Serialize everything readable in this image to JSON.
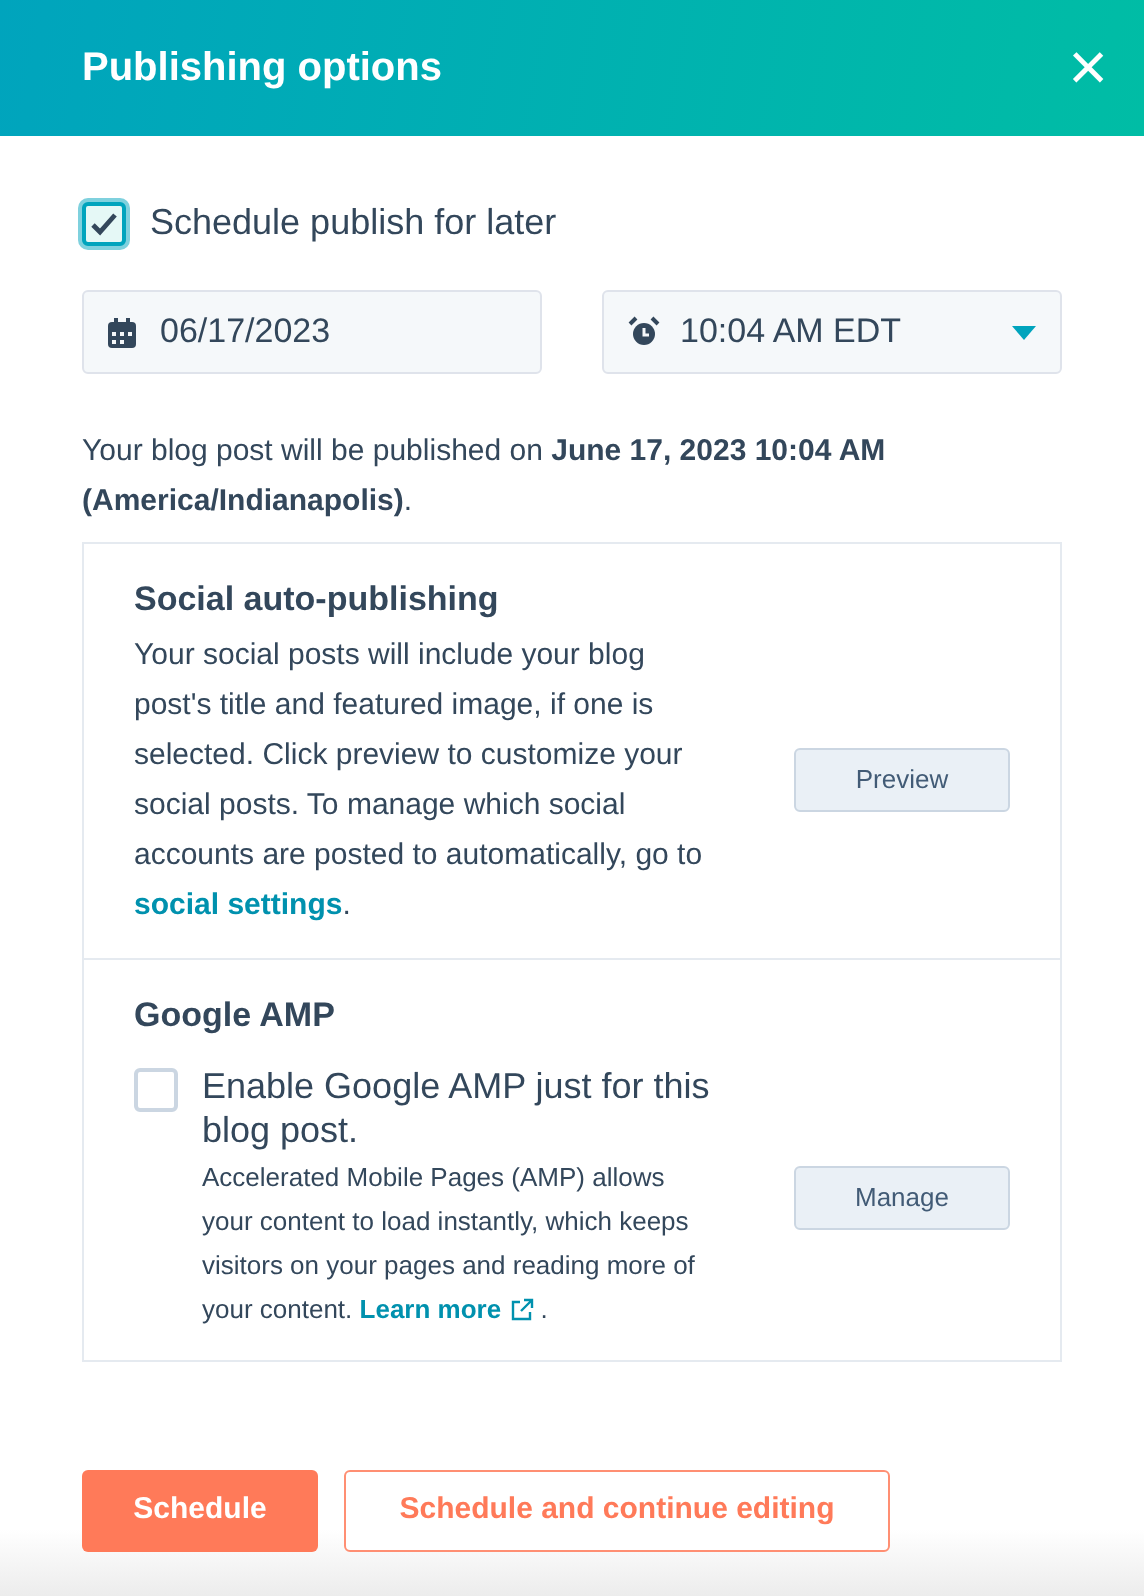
{
  "header": {
    "title": "Publishing options",
    "close": "×"
  },
  "schedule": {
    "label": "Schedule publish for later",
    "checked": true
  },
  "date": {
    "value": "06/17/2023"
  },
  "time": {
    "value": "10:04 AM EDT"
  },
  "notice": "Your blog post will be published on **June 17, 2023 10:04 AM (America/Indianapolis)**.",
  "sections": [
    {
      "kind": "social",
      "title": "Social auto-publishing",
      "text": "Your social posts will include your blog post's title and featured image, if one is selected. Click preview to customize your social posts. To manage which social accounts are posted to automatically, go to ",
      "link": "social settings",
      "suffix": ".",
      "button": "Preview"
    },
    {
      "kind": "amp",
      "title": "Google AMP",
      "checkbox_label": "Enable Google AMP just for this blog post.",
      "checked": false,
      "text": "Accelerated Mobile Pages (AMP) allows your content to load instantly, which keeps visitors on your pages and reading more of your content. ",
      "link": "Learn more",
      "suffix": " .",
      "button": "Manage"
    }
  ],
  "footer": {
    "buttons": [
      {
        "label": "Schedule",
        "kind": "primary"
      },
      {
        "label": "Schedule and continue editing",
        "kind": "secondary"
      }
    ]
  }
}
